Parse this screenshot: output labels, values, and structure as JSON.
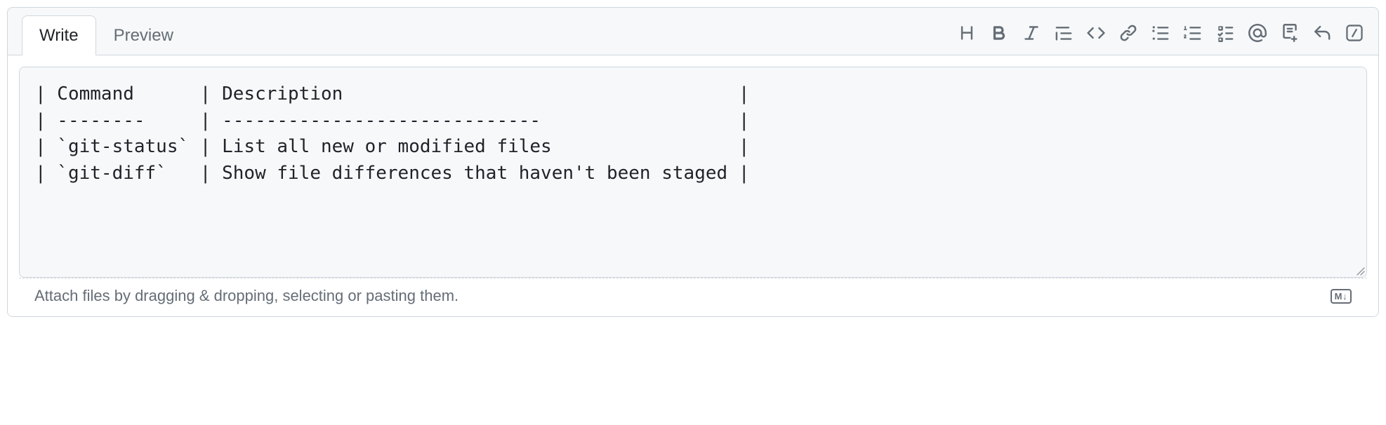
{
  "tabs": {
    "write": "Write",
    "preview": "Preview",
    "active": "write"
  },
  "toolbar": {
    "heading": "Heading",
    "bold": "Bold",
    "italic": "Italic",
    "quote": "Quote",
    "code": "Code",
    "link": "Link",
    "ul": "Unordered list",
    "ol": "Ordered list",
    "tasks": "Task list",
    "mention": "Mention",
    "reference": "Reference",
    "reply": "Saved replies",
    "slash": "Slash commands"
  },
  "editor": {
    "content": "| Command      | Description                                    |\n| --------     | -----------------------------                  |\n| `git-status` | List all new or modified files                 |\n| `git-diff`   | Show file differences that haven't been staged |"
  },
  "footer": {
    "hint": "Attach files by dragging & dropping, selecting or pasting them.",
    "markdown_badge": "M↓"
  }
}
